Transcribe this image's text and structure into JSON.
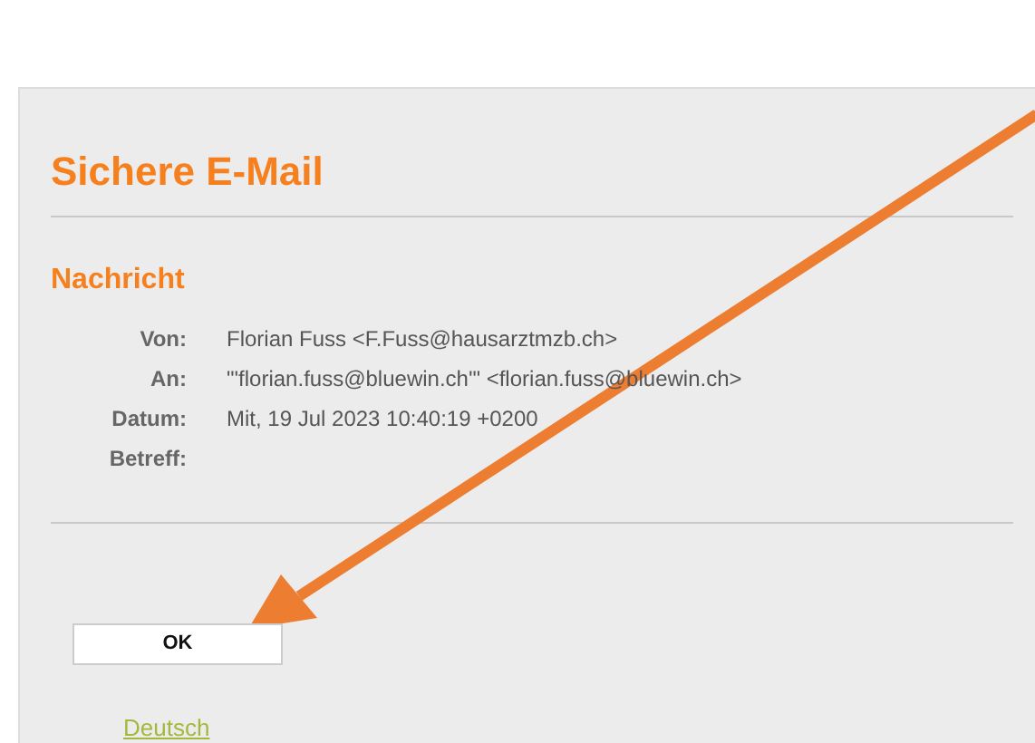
{
  "title": "Sichere E-Mail",
  "section": "Nachricht",
  "fields": [
    {
      "label": "Von:",
      "value": "Florian Fuss <F.Fuss@hausarztmzb.ch>"
    },
    {
      "label": "An:",
      "value": "\"'florian.fuss@bluewin.ch'\" <florian.fuss@bluewin.ch>"
    },
    {
      "label": "Datum:",
      "value": "Mit, 19 Jul 2023 10:40:19 +0200"
    },
    {
      "label": "Betreff:"
    }
  ],
  "ok_button": "OK",
  "language_link": "Deutsch"
}
